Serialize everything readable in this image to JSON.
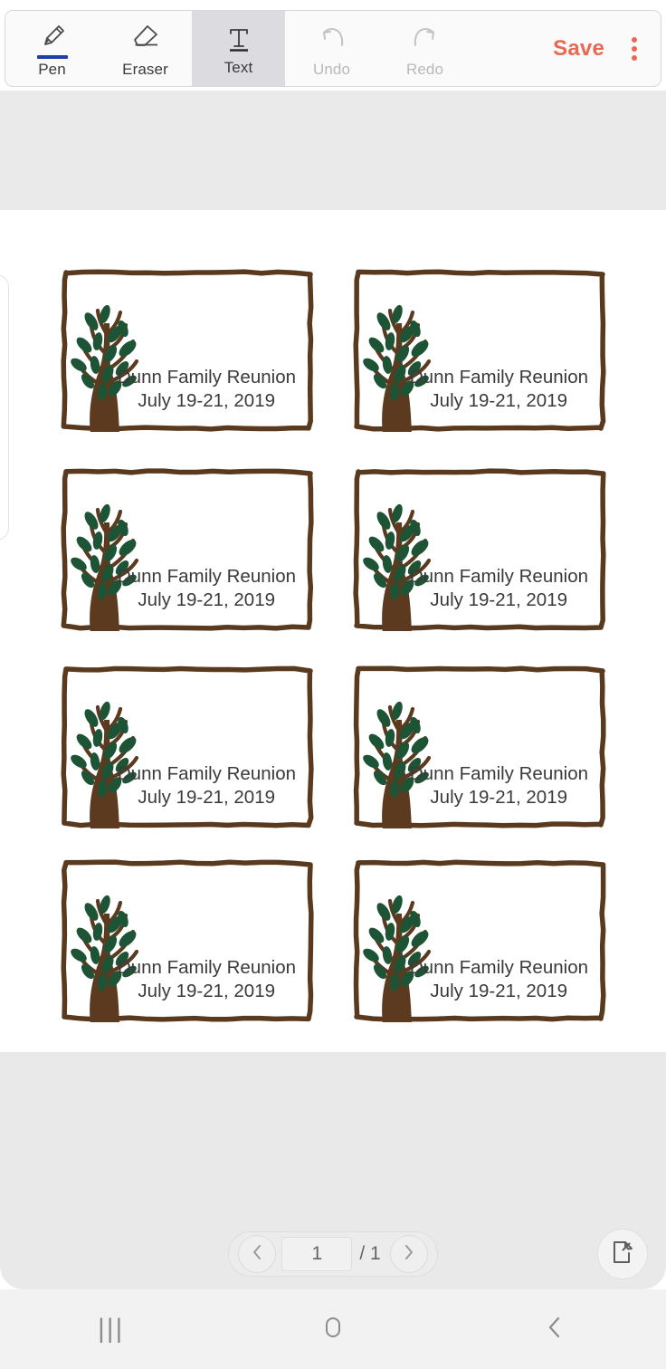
{
  "toolbar": {
    "tools": [
      {
        "label": "Pen",
        "icon": "pen-icon",
        "selected": false,
        "disabled": false,
        "accent": "#1F3FA8"
      },
      {
        "label": "Eraser",
        "icon": "eraser-icon",
        "selected": false,
        "disabled": false
      },
      {
        "label": "Text",
        "icon": "text-icon",
        "selected": true,
        "disabled": false
      },
      {
        "label": "Undo",
        "icon": "undo-icon",
        "selected": false,
        "disabled": true
      },
      {
        "label": "Redo",
        "icon": "redo-icon",
        "selected": false,
        "disabled": true
      }
    ],
    "save_label": "Save",
    "save_color": "#EA6852",
    "more_icon": "more-vertical-icon",
    "selected_highlight": "#DCDCE0"
  },
  "document": {
    "background": "#FFFFFF",
    "canvas_background": "#EAEAEA",
    "label_border_color": "#5A3A1E",
    "tree_trunk_color": "#5B3A20",
    "leaf_color": "#1E5436",
    "text_color": "#3A3A3A",
    "labels": [
      {
        "title": "Dunn Family Reunion",
        "date": "July 19-21, 2019"
      },
      {
        "title": "Dunn Family  Reunion",
        "date": "July 19-21, 2019"
      },
      {
        "title": "Dunn Family Reunion",
        "date": "July 19-21, 2019"
      },
      {
        "title": "Dunn Family  Reunion",
        "date": "July 19-21, 2019"
      },
      {
        "title": "Dunn Family Reunion",
        "date": "July 19-21, 2019"
      },
      {
        "title": "Dunn Family  Reunion",
        "date": "July 19-21, 2019"
      },
      {
        "title": "Dunn Family Reunion",
        "date": "July 19-21, 2019"
      },
      {
        "title": "Dunn Family  Reunion",
        "date": "July 19-21, 2019"
      }
    ]
  },
  "page_nav": {
    "prev_icon": "chevron-left-icon",
    "next_icon": "chevron-right-icon",
    "current_page": "1",
    "total_pages": "/ 1",
    "pin_icon": "pin-page-icon"
  },
  "android_nav": {
    "recents_icon": "recents-icon",
    "recents_glyph": "|||",
    "home_icon": "home-icon",
    "back_icon": "back-icon"
  }
}
